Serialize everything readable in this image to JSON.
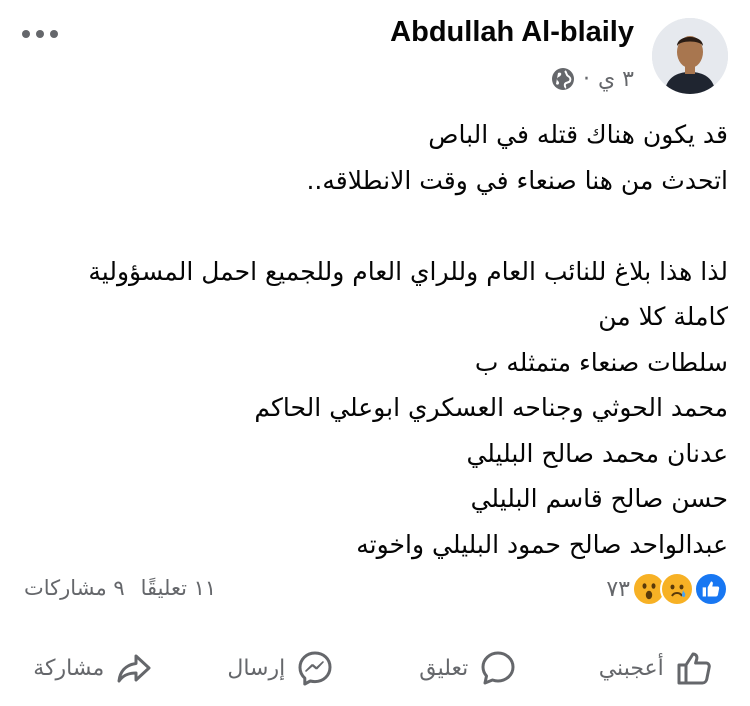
{
  "post": {
    "author": "Abdullah Al-blaily",
    "time": "٣ ي",
    "separator": "·",
    "lines": [
      "قد يكون هناك قتله في الباص",
      "اتحدث من هنا صنعاء في وقت الانطلاقه..",
      "",
      "لذا هذا بلاغ للنائب العام وللراي العام وللجميع احمل المسؤولية",
      "كاملة كلا من",
      "سلطات صنعاء متمثله ب",
      "محمد الحوثي وجناحه العسكري ابوعلي الحاكم",
      "عدنان محمد صالح البليلي",
      "حسن صالح قاسم البليلي",
      "عبدالواحد صالح حمود البليلي واخوته"
    ]
  },
  "stats": {
    "reaction_icons": [
      "like-icon",
      "sad-icon",
      "wow-icon"
    ],
    "reaction_count": "٧٣",
    "comments": "١١ تعليقًا",
    "shares": "٩ مشاركات"
  },
  "actions": {
    "like": "أعجبني",
    "comment": "تعليق",
    "send": "إرسال",
    "share": "مشاركة"
  },
  "colors": {
    "primary_text": "#050505",
    "secondary_text": "#65676b",
    "like_blue": "#1877f2",
    "emoji_yellow": "#f7b125"
  }
}
